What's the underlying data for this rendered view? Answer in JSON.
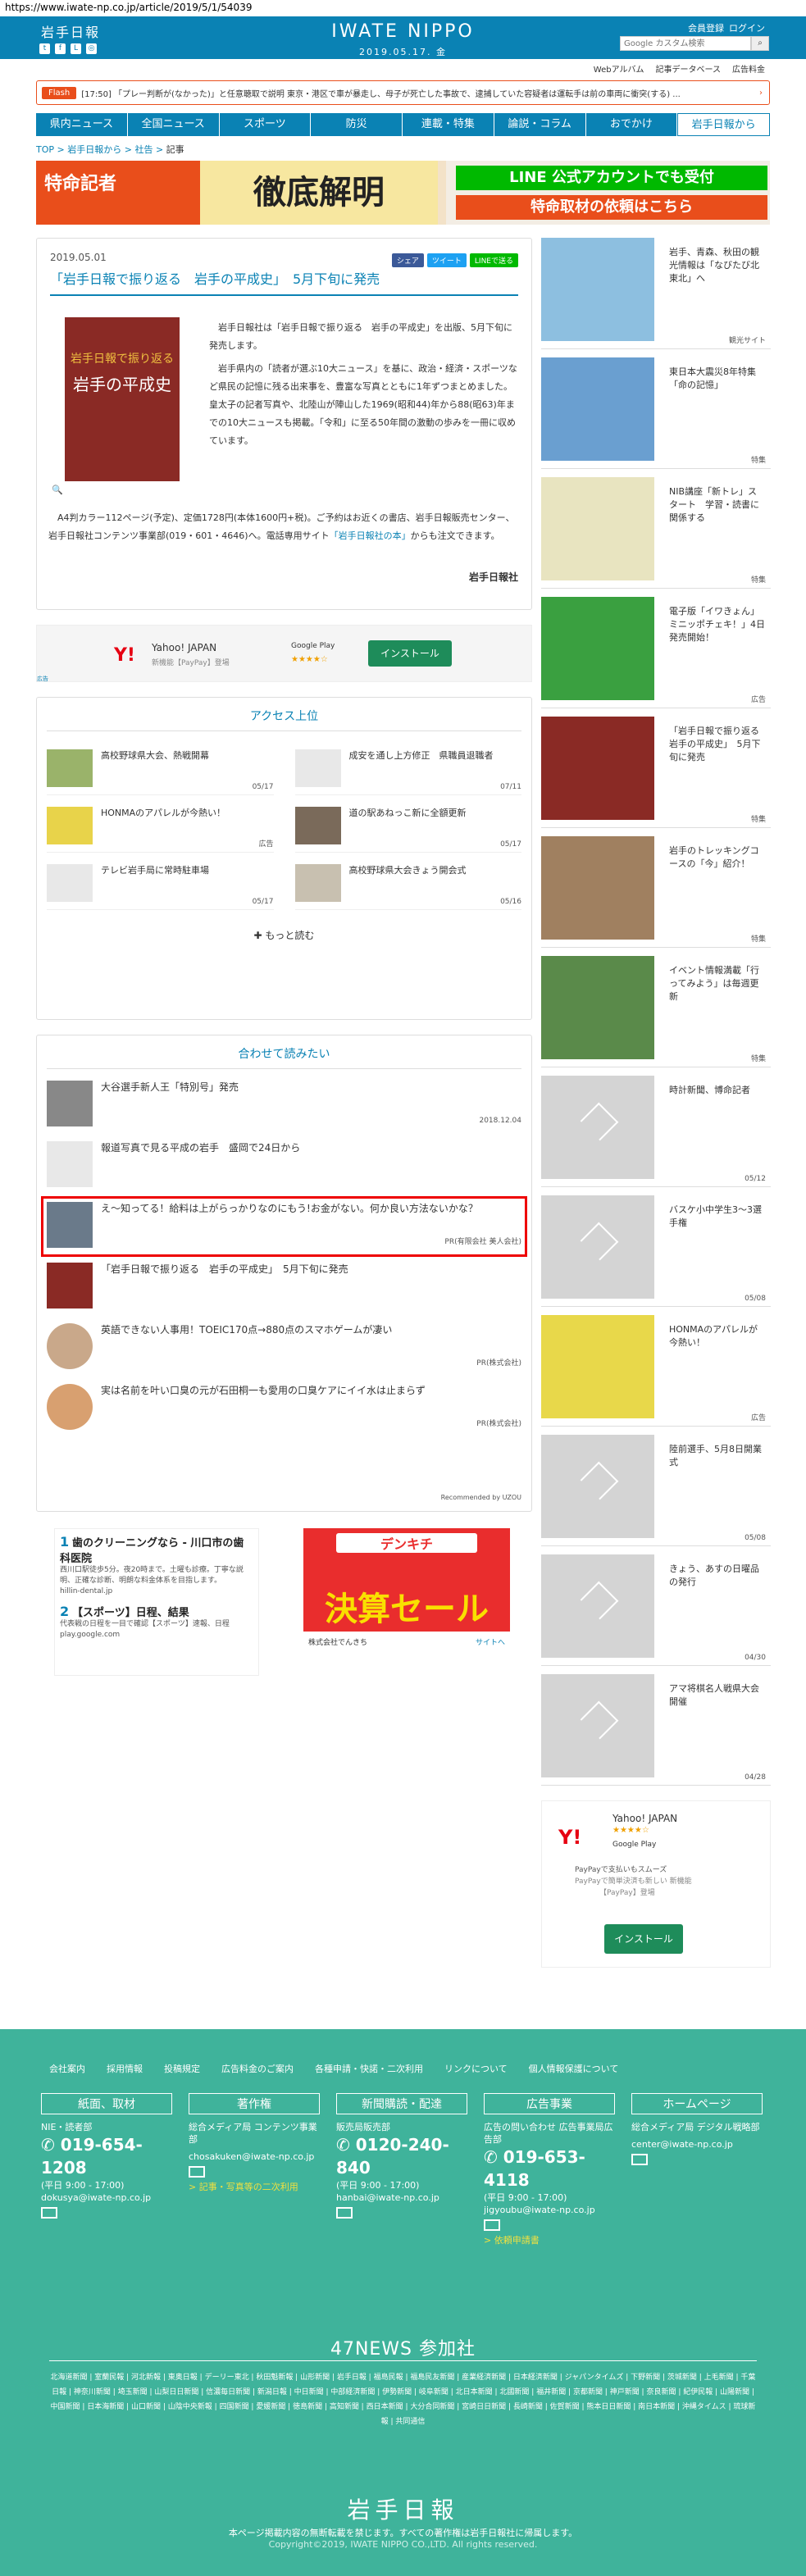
{
  "browser": {
    "url": "https://www.iwate-np.co.jp/article/2019/5/1/54039"
  },
  "header": {
    "logo_small": "岩手日報",
    "logo_main": "IWATE NIPPO",
    "date": "2019.05.17. 金",
    "links": [
      "会員登録",
      "ログイン"
    ],
    "search_placeholder": "Google カスタム検索",
    "sublinks": [
      "Webアルバム",
      "記事データベース",
      "広告料金"
    ]
  },
  "flash": {
    "tag": "Flash",
    "text": "[17:50] 「プレー判断が(なかった)」と任意聴取で説明  東京・港区で車が暴走し、母子が死亡した事故で、逮捕していた容疑者は運転手は前の車両に衝突(する) ..."
  },
  "nav": {
    "items": [
      "県内ニュース",
      "全国ニュース",
      "スポーツ",
      "防災",
      "連載・特集",
      "論説・コラム",
      "おでかけ",
      "岩手日報から"
    ]
  },
  "breadcrumb": [
    "TOP",
    "岩手日報から",
    "社告",
    "記事"
  ],
  "banner": {
    "left_text": "特命記者",
    "mid_text": "徹底解明",
    "line1": "LINE 公式アカウントでも受付",
    "line2": "特命取材の依頼はこちら"
  },
  "article": {
    "date": "2019.05.01",
    "share": [
      "シェア",
      "ツイート",
      "LINEで送る"
    ],
    "title": "「岩手日報で振り返る　岩手の平成史」　5月下旬に発売",
    "cover_top": "岩手日報で振り返る",
    "cover_title": "岩手の平成史",
    "body1": "岩手日報社は「岩手日報で振り返る　岩手の平成史」を出版、5月下旬に発売します。",
    "body2": "岩手県内の「読者が選ぶ10大ニュース」を基に、政治・経済・スポーツなど県民の記憶に残る出来事を、豊富な写真とともに1年ずつまとめました。皇太子の記者写真や、北陸山が陣山した1969(昭和44)年から88(昭63)年までの10大ニュースも掲載。「令和」に至る50年間の激動の歩みを一冊に収めています。",
    "body3": "A4判カラー112ページ(予定)、定価1728円(本体1600円+税)。ご予約はお近くの書店、岩手日報販売センター、岩手日報社コンテンツ事業部(019・601・4646)へ。電話専用サイト",
    "body3_link": "「岩手日報社の本」",
    "body3_end": "からも注文できます。",
    "credit": "岩手日報社"
  },
  "ad_inline": {
    "brand": "Y!",
    "title": "Yahoo! JAPAN",
    "sub": "新機能【PayPay】登場",
    "store": "Google Play",
    "stars": "★★★★☆",
    "button": "インストール",
    "caption": "広告"
  },
  "ranking": {
    "title": "アクセス上位",
    "items": [
      {
        "text": "高校野球県大会、熱戦開幕",
        "date": "05/17"
      },
      {
        "text": "成安を通し上方修正　県職員退職者",
        "date": "07/11"
      },
      {
        "text": "HONMAのアパレルが今熱い！",
        "date": "広告"
      },
      {
        "text": "道の駅あねっこ新に全額更新",
        "date": "05/17"
      },
      {
        "text": "テレビ岩手局に常時駐車場",
        "date": "05/17"
      },
      {
        "text": "高校野球県大会きょう開会式",
        "date": "05/16"
      }
    ],
    "more": "もっと読む"
  },
  "related": {
    "title": "合わせて読みたい",
    "items": [
      {
        "text": "大谷選手新人王「特別号」発売",
        "date": "2018.12.04"
      },
      {
        "text": "報道写真で見る平成の岩手　盛岡で24日から",
        "date": ""
      },
      {
        "text": "え〜知ってる！給料は上がらっかりなのにもう!お金がない。何か良い方法ないかな？",
        "date": "PR(有限会社 美人会社)"
      },
      {
        "text": "「岩手日報で振り返る　岩手の平成史」　5月下旬に発売",
        "date": ""
      },
      {
        "text": "英語できない人事用！TOEIC170点→880点のスマホゲームが凄い",
        "date": "PR(株式会社)"
      },
      {
        "text": "実は名前を叶い口臭の元が石田桐一も愛用の口臭ケアにイイ水は止まらず",
        "date": "PR(株式会社)"
      }
    ],
    "recommend": "Recommended by UZOU"
  },
  "ad_bottom": {
    "item1_num": "1",
    "item1_title": "歯のクリーニングなら - 川口市の歯科医院",
    "item1_desc": "西川口駅徒歩5分。夜20時まで。土曜も診療。丁寧な説明、正確な診断、明朗な料金体系を目指します。",
    "item1_src": "hillin-dental.jp",
    "item2_num": "2",
    "item2_title": "【スポーツ】日程、結果",
    "item2_desc": "代表戦の日程を一目で確認【スポーツ】速報、日程",
    "item2_src": "play.google.com",
    "item3_top": "デンキチ",
    "item3_big": "決算セール",
    "item3_cap": "株式会社でんきち",
    "item3_site": "サイトへ"
  },
  "sidebar": {
    "items": [
      {
        "text": "岩手、青森、秋田の観光情報は「なびたび北東北」へ",
        "cat": "観光サイト"
      },
      {
        "text": "東日本大震災8年特集「命の記憶」",
        "cat": "特集"
      },
      {
        "text": "NIB講座「新トレ」スタート　学習・読書に関係する",
        "cat": "特集"
      },
      {
        "text": "電子版「イワきょん」ミニッポチェキ！」4日発売開始！",
        "cat": "広告"
      },
      {
        "text": "「岩手日報で振り返る　岩手の平成史」　5月下旬に発売",
        "cat": "特集"
      },
      {
        "text": "岩手のトレッキングコースの「今」紹介！",
        "cat": "特集"
      },
      {
        "text": "イベント情報満載「行ってみよう」は毎週更新",
        "cat": "特集"
      },
      {
        "text": "時計新聞、博命記者",
        "cat": "05/12"
      },
      {
        "text": "バスケ小中学生3〜3選手権",
        "cat": "05/08"
      },
      {
        "text": "HONMAのアパレルが今熱い！",
        "cat": "広告"
      },
      {
        "text": "陸前選手、5月8日開業式",
        "cat": "05/08"
      },
      {
        "text": "きょう、あすの日曜品の発行",
        "cat": "04/30"
      },
      {
        "text": "アマ将棋名人戦県大会開催",
        "cat": "04/28"
      }
    ]
  },
  "side_ad": {
    "brand": "Y!",
    "title": "Yahoo! JAPAN",
    "stars": "★★★★☆",
    "store": "Google Play",
    "d1": "PayPayで支払いもスムーズ",
    "d2": "PayPayで簡単決済も新しい 新機能",
    "d3": "【PayPay】登場",
    "button": "インストール"
  },
  "footer": {
    "links": [
      "会社案内",
      "採用情報",
      "投稿規定",
      "広告料金のご案内",
      "各種申請・快諾・二次利用",
      "リンクについて",
      "個人情報保護について"
    ],
    "cols": [
      {
        "head": "紙面、取材",
        "label": "NIE・読者部",
        "tel": "019-654-1208",
        "hours": "(平日 9:00 - 17:00)",
        "mail": "dokusya@iwate-np.co.jp",
        "note": ""
      },
      {
        "head": "著作権",
        "label": "総合メディア局 コンテンツ事業部",
        "tel": "",
        "hours": "",
        "mail": "chosakuken@iwate-np.co.jp",
        "note": "> 記事・写真等の二次利用"
      },
      {
        "head": "新聞購読・配達",
        "label": "販売局販売部",
        "tel": "0120-240-840",
        "hours": "(平日 9:00 - 17:00)",
        "mail": "hanbai@iwate-np.co.jp",
        "note": ""
      },
      {
        "head": "広告事業",
        "label": "広告の問い合わせ 広告事業局広告部",
        "tel": "019-653-4118",
        "hours": "(平日 9:00 - 17:00)",
        "mail": "jigyoubu@iwate-np.co.jp",
        "note": "> 依頼申請書"
      },
      {
        "head": "ホームページ",
        "label": "総合メディア局 デジタル戦略部",
        "tel": "",
        "hours": "",
        "mail": "center@iwate-np.co.jp",
        "note": ""
      }
    ],
    "news47": "47NEWS 参加社",
    "papers": "北海道新聞 | 室蘭民報 | 河北新報 | 東奥日報 | デーリー東北 | 秋田魁新報 | 山形新聞 | 岩手日報 | 福島民報 | 福島民友新聞 | 産業経済新聞 | 日本経済新聞 | ジャパンタイムズ | 下野新聞 | 茨城新聞 | 上毛新聞 | 千葉日報 | 神奈川新聞 | 埼玉新聞 | 山梨日日新聞 | 信濃毎日新聞 | 新潟日報 | 中日新聞 | 中部経済新聞 | 伊勢新聞 | 岐阜新聞 | 北日本新聞 | 北國新聞 | 福井新聞 | 京都新聞 | 神戸新聞 | 奈良新聞 | 紀伊民報 | 山陽新聞 | 中国新聞 | 日本海新聞 | 山口新聞 | 山陰中央新報 | 四国新聞 | 愛媛新聞 | 徳島新聞 | 高知新聞 | 西日本新聞 | 大分合同新聞 | 宮崎日日新聞 | 長崎新聞 | 佐賀新聞 | 熊本日日新聞 | 南日本新聞 | 沖縄タイムス | 琉球新報 | 共同通信",
    "logo": "岩手日報",
    "copy1": "本ページ掲載内容の無断転載を禁じます。すべての著作権は岩手日報社に帰属します。",
    "copy2": "Copyright©2019, IWATE NIPPO CO.,LTD. All rights reserved."
  }
}
